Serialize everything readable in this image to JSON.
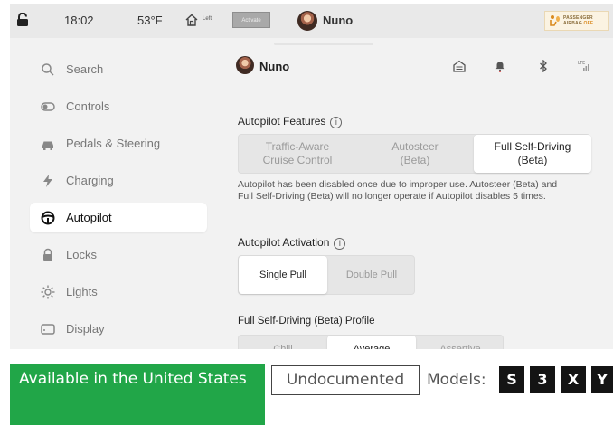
{
  "status_bar": {
    "time": "18:02",
    "temperature": "53°F",
    "home_sublabel": "Left",
    "activate_label": "Activate",
    "user_name": "Nuno",
    "airbag_line1": "PASSENGER",
    "airbag_line2": "AIRBAG",
    "airbag_state": "OFF"
  },
  "sidebar": {
    "items": [
      {
        "label": "Search",
        "icon": "search-icon"
      },
      {
        "label": "Controls",
        "icon": "toggle-icon"
      },
      {
        "label": "Pedals & Steering",
        "icon": "car-icon"
      },
      {
        "label": "Charging",
        "icon": "bolt-icon"
      },
      {
        "label": "Autopilot",
        "icon": "steering-wheel-icon",
        "active": true
      },
      {
        "label": "Locks",
        "icon": "lock-icon"
      },
      {
        "label": "Lights",
        "icon": "sun-icon"
      },
      {
        "label": "Display",
        "icon": "display-icon"
      }
    ]
  },
  "main": {
    "user_name": "Nuno",
    "header_icons": [
      "garage-icon",
      "bell-icon",
      "bluetooth-icon",
      "signal-icon"
    ],
    "features_title": "Autopilot Features",
    "features_options": [
      {
        "line1": "Traffic-Aware",
        "line2": "Cruise Control"
      },
      {
        "line1": "Autosteer",
        "line2": "(Beta)"
      },
      {
        "line1": "Full Self-Driving",
        "line2": "(Beta)"
      }
    ],
    "features_selected": "Full Self-Driving (Beta)",
    "warning_text": "Autopilot has been disabled once due to improper use. Autosteer (Beta) and Full Self-Driving (Beta) will no longer operate if Autopilot disables 5 times.",
    "activation_title": "Autopilot Activation",
    "activation_options": [
      "Single Pull",
      "Double Pull"
    ],
    "activation_selected": "Single Pull",
    "profile_title": "Full Self-Driving (Beta) Profile",
    "profile_options": [
      "Chill",
      "Average",
      "Assertive"
    ],
    "profile_selected": "Average"
  },
  "footer": {
    "availability": "Available in the United States",
    "availability_color": "#21a648",
    "documentation_status": "Undocumented",
    "models_label": "Models:",
    "models": [
      "S",
      "3",
      "X",
      "Y"
    ]
  }
}
